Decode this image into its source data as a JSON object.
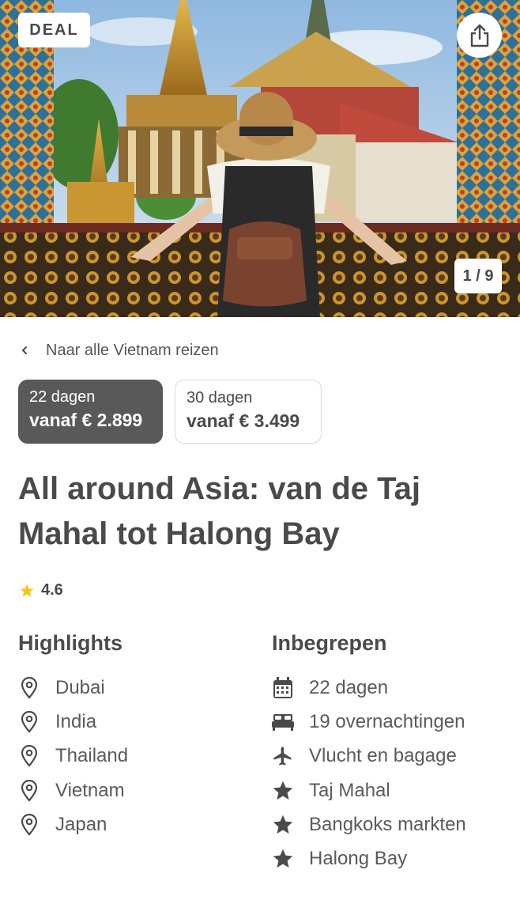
{
  "hero": {
    "badge": "DEAL",
    "counter": "1 / 9",
    "share_icon": "share-icon"
  },
  "back_link": {
    "label": "Naar alle Vietnam reizen"
  },
  "options": [
    {
      "days": "22 dagen",
      "price": "vanaf € 2.899",
      "selected": true
    },
    {
      "days": "30 dagen",
      "price": "vanaf € 3.499",
      "selected": false
    }
  ],
  "title": "All around Asia: van de Taj Mahal tot Halong Bay",
  "rating": {
    "value": "4.6",
    "star_color": "#f5c518"
  },
  "highlights": {
    "heading": "Highlights",
    "items": [
      {
        "icon": "location-pin-icon",
        "label": "Dubai"
      },
      {
        "icon": "location-pin-icon",
        "label": "India"
      },
      {
        "icon": "location-pin-icon",
        "label": "Thailand"
      },
      {
        "icon": "location-pin-icon",
        "label": "Vietnam"
      },
      {
        "icon": "location-pin-icon",
        "label": "Japan"
      }
    ]
  },
  "included": {
    "heading": "Inbegrepen",
    "items": [
      {
        "icon": "calendar-icon",
        "label": "22 dagen"
      },
      {
        "icon": "bed-icon",
        "label": "19 overnachtingen"
      },
      {
        "icon": "airplane-icon",
        "label": "Vlucht en bagage"
      },
      {
        "icon": "star-icon",
        "label": "Taj Mahal"
      },
      {
        "icon": "star-icon",
        "label": "Bangkoks markten"
      },
      {
        "icon": "star-icon",
        "label": "Halong Bay"
      }
    ]
  },
  "colors": {
    "selected_option_bg": "#595959",
    "text": "#4a4a4a",
    "icon": "#4a4a4a"
  }
}
